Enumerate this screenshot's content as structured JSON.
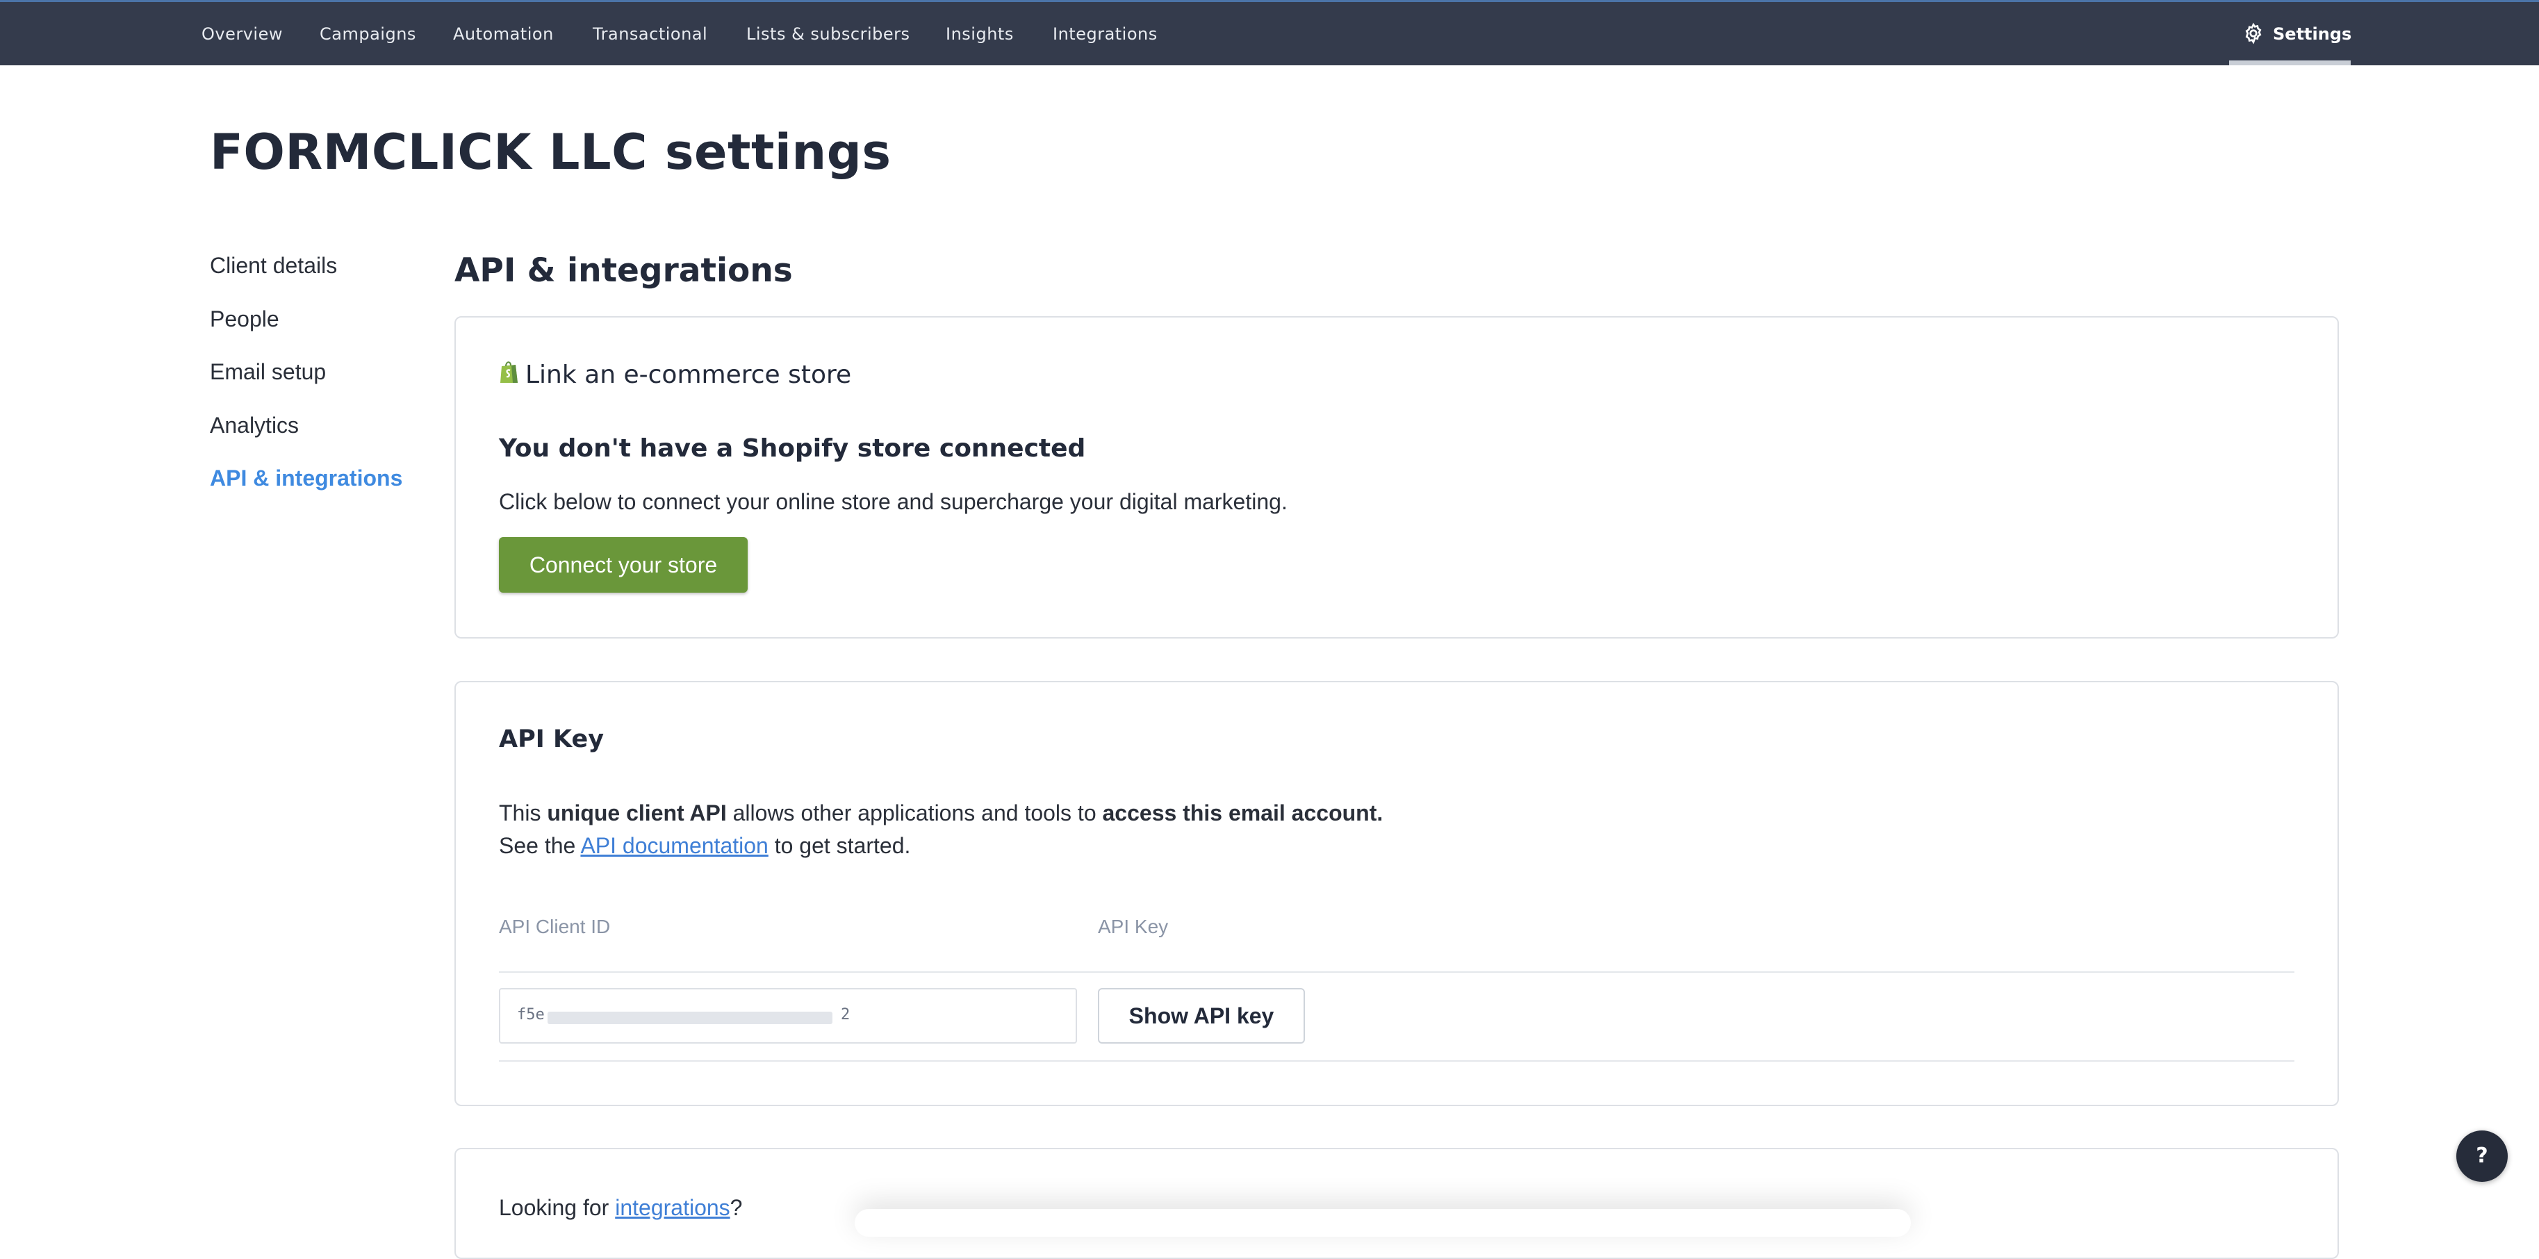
{
  "nav": {
    "items": [
      "Overview",
      "Campaigns",
      "Automation",
      "Transactional",
      "Lists & subscribers",
      "Insights",
      "Integrations"
    ],
    "settings_label": "Settings",
    "settings_icon": "gear-icon"
  },
  "page_title": "FORMCLICK LLC settings",
  "sidebar": {
    "items": [
      "Client details",
      "People",
      "Email setup",
      "Analytics",
      "API & integrations"
    ],
    "active": "API & integrations",
    "active_color": "#3f8ae0"
  },
  "section_title": "API & integrations",
  "ecommerce": {
    "icon": "shopify-bag-icon",
    "heading": "Link an e-commerce store",
    "subheading": "You don't have a Shopify store connected",
    "description": "Click below to connect your online store and supercharge your digital marketing.",
    "button_label": "Connect your store",
    "button_color": "#6a973a"
  },
  "api_key": {
    "heading": "API Key",
    "desc_1": "This ",
    "desc_bold_1": "unique client API",
    "desc_2": " allows other applications and tools to ",
    "desc_bold_2": "access this email account.",
    "desc_3": "See the ",
    "desc_link": "API documentation",
    "desc_4": " to get started.",
    "client_id_label": "API Client ID",
    "key_label": "API Key",
    "client_id_prefix": "f5e",
    "client_id_suffix": "2",
    "show_button_label": "Show API key"
  },
  "integrations_card": {
    "text": "Looking for ",
    "link": "integrations",
    "suffix": "?"
  },
  "help": {
    "label": "?"
  }
}
